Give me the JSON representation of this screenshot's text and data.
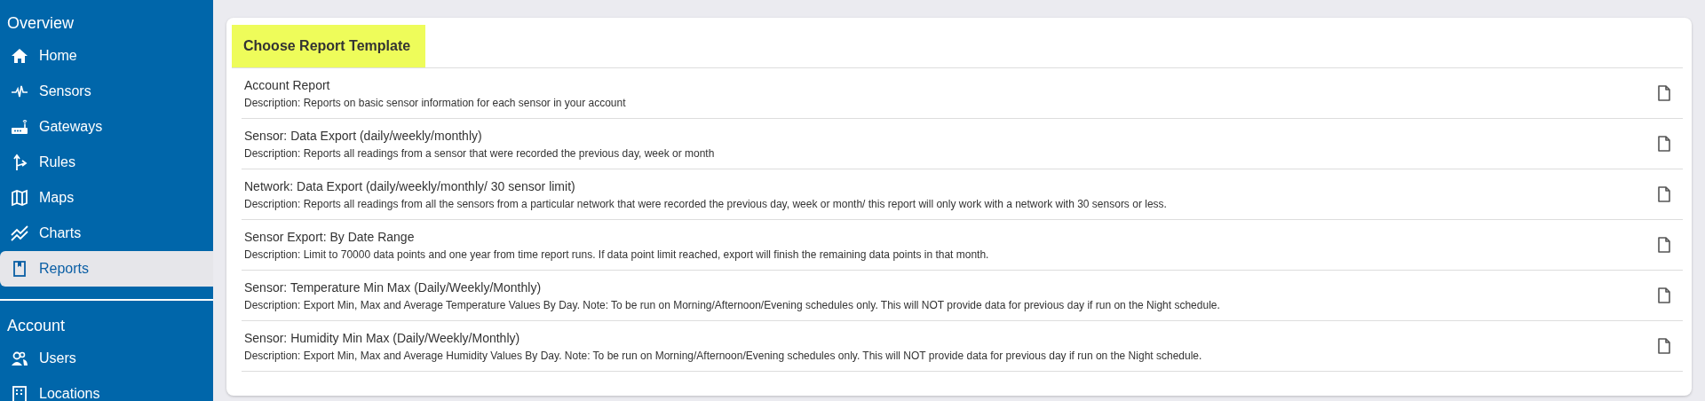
{
  "sidebar": {
    "sections": [
      {
        "title": "Overview",
        "items": [
          {
            "label": "Home",
            "selected": false
          },
          {
            "label": "Sensors",
            "selected": false
          },
          {
            "label": "Gateways",
            "selected": false
          },
          {
            "label": "Rules",
            "selected": false
          },
          {
            "label": "Maps",
            "selected": false
          },
          {
            "label": "Charts",
            "selected": false
          },
          {
            "label": "Reports",
            "selected": true
          }
        ]
      },
      {
        "title": "Account",
        "items": [
          {
            "label": "Users",
            "selected": false
          },
          {
            "label": "Locations",
            "selected": false
          }
        ]
      }
    ]
  },
  "report_templates": {
    "title": "Choose Report Template",
    "rows": [
      {
        "name": "Account Report",
        "description": "Description: Reports on basic sensor information for each sensor in your account"
      },
      {
        "name": "Sensor: Data Export (daily/weekly/monthly)",
        "description": "Description: Reports all readings from a sensor that were recorded the previous day, week or month"
      },
      {
        "name": "Network: Data Export (daily/weekly/monthly/ 30 sensor limit)",
        "description": "Description: Reports all readings from all the sensors from a particular network that were recorded the previous day, week or month/ this report will only work with a network with 30 sensors or less."
      },
      {
        "name": "Sensor Export: By Date Range",
        "description": "Description: Limit to 70000 data points and one year from time report runs. If data point limit reached, export will finish the remaining data points in that month."
      },
      {
        "name": "Sensor: Temperature Min Max (Daily/Weekly/Monthly)",
        "description": "Description: Export Min, Max and Average Temperature Values By Day. Note: To be run on Morning/Afternoon/Evening schedules only. This will NOT provide data for previous day if run on the Night schedule."
      },
      {
        "name": "Sensor: Humidity Min Max (Daily/Weekly/Monthly)",
        "description": "Description: Export Min, Max and Average Humidity Values By Day. Note: To be run on Morning/Afternoon/Evening schedules only. This will NOT provide data for previous day if run on the Night schedule."
      }
    ]
  }
}
